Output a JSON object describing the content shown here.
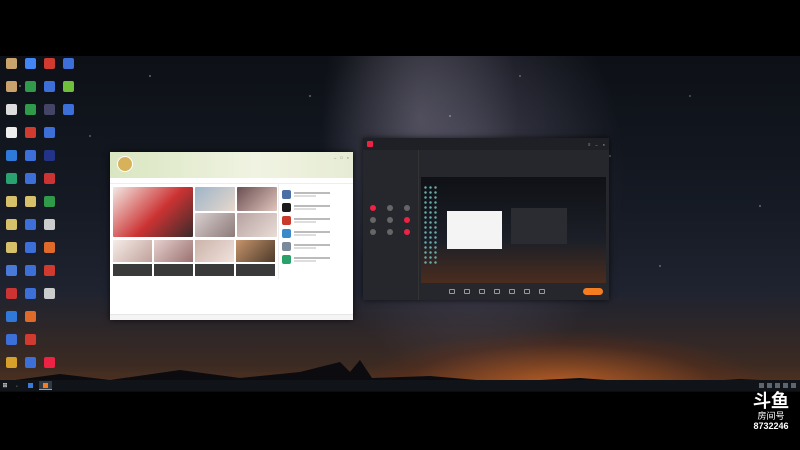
{
  "desktop": {
    "icons": [
      {
        "label": "",
        "color": "#c9a36b"
      },
      {
        "label": "",
        "color": "#4285f4"
      },
      {
        "label": "",
        "color": "#d13b2f"
      },
      {
        "label": "",
        "color": "#3d6fd8"
      },
      {
        "label": "",
        "color": "#c9a36b"
      },
      {
        "label": "",
        "color": "#2f9a4a"
      },
      {
        "label": "",
        "color": "#3d6fd8"
      },
      {
        "label": "",
        "color": "#6fbf3a"
      },
      {
        "label": "",
        "color": "#dddddd"
      },
      {
        "label": "",
        "color": "#2f9a4a"
      },
      {
        "label": "",
        "color": "#444466"
      },
      {
        "label": "",
        "color": "#3d6fd8"
      },
      {
        "label": "",
        "color": "#eeeeee"
      },
      {
        "label": "",
        "color": "#d13b2f"
      },
      {
        "label": "",
        "color": "#3d6fd8"
      },
      {
        "label": "",
        "color": ""
      },
      {
        "label": "",
        "color": "#2f7ad8"
      },
      {
        "label": "",
        "color": "#3d6fd8"
      },
      {
        "label": "",
        "color": "#223388"
      },
      {
        "label": "",
        "color": ""
      },
      {
        "label": "",
        "color": "#29a26f"
      },
      {
        "label": "",
        "color": "#3d6fd8"
      },
      {
        "label": "",
        "color": "#c33"
      },
      {
        "label": "",
        "color": ""
      },
      {
        "label": "",
        "color": "#d7c06a"
      },
      {
        "label": "",
        "color": "#d7c06a"
      },
      {
        "label": "",
        "color": "#2f9a4a"
      },
      {
        "label": "",
        "color": ""
      },
      {
        "label": "",
        "color": "#d7c06a"
      },
      {
        "label": "",
        "color": "#3d6fd8"
      },
      {
        "label": "",
        "color": "#cccccc"
      },
      {
        "label": "",
        "color": ""
      },
      {
        "label": "",
        "color": "#d7c06a"
      },
      {
        "label": "",
        "color": "#3d6fd8"
      },
      {
        "label": "",
        "color": "#e06a2a"
      },
      {
        "label": "",
        "color": ""
      },
      {
        "label": "",
        "color": "#4a7ad8"
      },
      {
        "label": "",
        "color": "#3d6fd8"
      },
      {
        "label": "",
        "color": "#d13b2f"
      },
      {
        "label": "",
        "color": ""
      },
      {
        "label": "",
        "color": "#c33"
      },
      {
        "label": "",
        "color": "#3d6fd8"
      },
      {
        "label": "",
        "color": "#cccccc"
      },
      {
        "label": "",
        "color": ""
      },
      {
        "label": "",
        "color": "#2f7ad8"
      },
      {
        "label": "",
        "color": "#e06a2a"
      },
      {
        "label": "",
        "color": ""
      },
      {
        "label": "",
        "color": ""
      },
      {
        "label": "",
        "color": "#3d6fd8"
      },
      {
        "label": "",
        "color": "#d13b2f"
      },
      {
        "label": "",
        "color": ""
      },
      {
        "label": "",
        "color": ""
      },
      {
        "label": "",
        "color": "#d7a02a"
      },
      {
        "label": "",
        "color": "#3d6fd8"
      },
      {
        "label": "",
        "color": "#e24"
      },
      {
        "label": "",
        "color": ""
      },
      {
        "label": "",
        "color": "#c33"
      },
      {
        "label": "",
        "color": "#c33"
      },
      {
        "label": "",
        "color": "#2fbf3a"
      },
      {
        "label": "",
        "color": ""
      }
    ]
  },
  "watermark": {
    "logo": "斗鱼",
    "room_label": "房间号",
    "room_number": "8732246"
  },
  "colors": {
    "accent": "#f57c1f",
    "douyu_red": "#e24444"
  }
}
